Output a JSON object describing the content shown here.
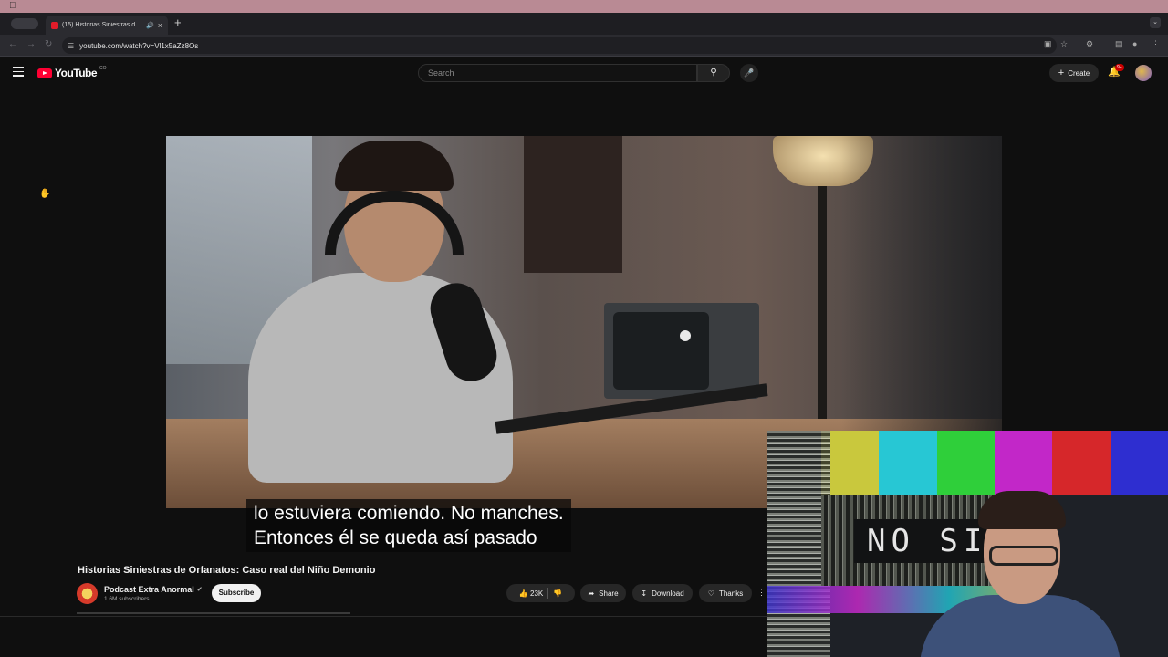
{
  "browser": {
    "tab_title": "(15) Historias Siniestras d",
    "url": "youtube.com/watch?v=Vl1x5aZz8Os"
  },
  "youtube": {
    "logo_text": "YouTube",
    "logo_super": "CO",
    "search_placeholder": "Search",
    "create_label": "Create",
    "notification_badge": "9+"
  },
  "video": {
    "captions": [
      "lo estuviera comiendo. No manches.",
      "Entonces él se queda así pasado"
    ],
    "title": "Historias Siniestras de Orfanatos: Caso real del Niño Demonio",
    "channel_name": "Podcast Extra Anormal",
    "subscribers": "1.6M subscribers",
    "subscribe_label": "Subscribe",
    "likes": "23K",
    "share_label": "Share",
    "download_label": "Download",
    "thanks_label": "Thanks"
  },
  "webcam": {
    "overlay_text": "NO SI",
    "bar_colors": [
      "#c9c83d",
      "#27c7d4",
      "#2fcf3a",
      "#c227c8",
      "#d6272a",
      "#2e2ed0"
    ]
  }
}
